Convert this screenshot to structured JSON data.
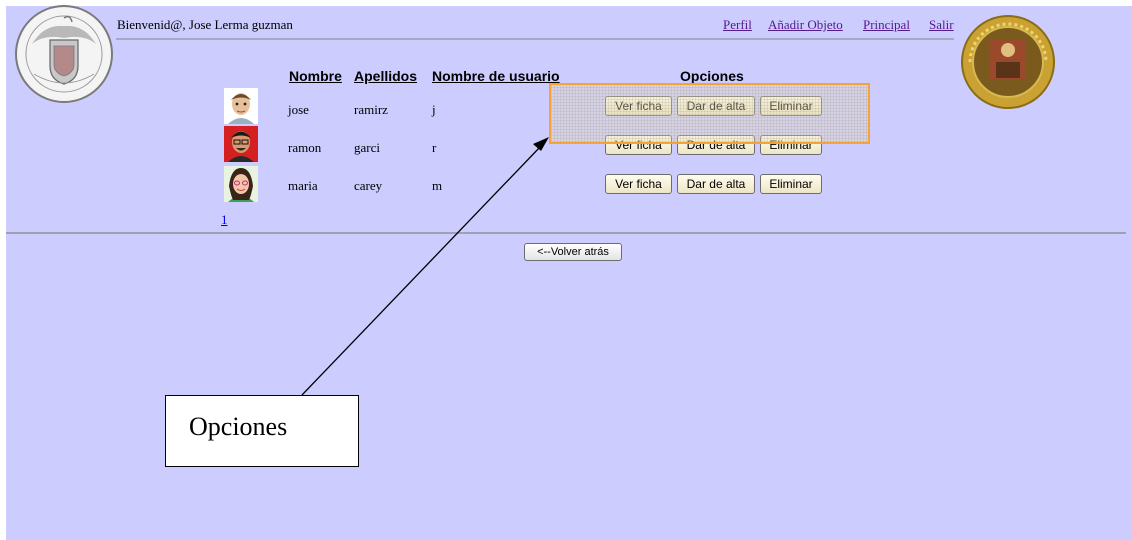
{
  "header": {
    "welcome": "Bienvenid@, Jose Lerma guzman",
    "links": [
      "Perfil",
      "Añadir Objeto",
      "Principal",
      "Salir"
    ]
  },
  "table": {
    "columns": [
      "Nombre",
      "Apellidos",
      "Nombre de usuario",
      "Opciones"
    ],
    "rows": [
      {
        "nombre": "jose",
        "apellidos": "ramirz",
        "usuario": "j"
      },
      {
        "nombre": "ramon",
        "apellidos": "garci",
        "usuario": "r"
      },
      {
        "nombre": "maria",
        "apellidos": "carey",
        "usuario": "m"
      }
    ],
    "actions": {
      "ver": "Ver ficha",
      "alta": "Dar de alta",
      "eliminar": "Eliminar"
    }
  },
  "pagination": {
    "page": "1"
  },
  "back_button": "<--Volver atrás",
  "annotation": {
    "label": "Opciones",
    "highlight_color": "#f7a234"
  },
  "colors": {
    "background": "#ccccff",
    "link": "#551a8b"
  },
  "icons": [
    "seal-left-icon",
    "seal-right-icon",
    "avatar-icon"
  ]
}
